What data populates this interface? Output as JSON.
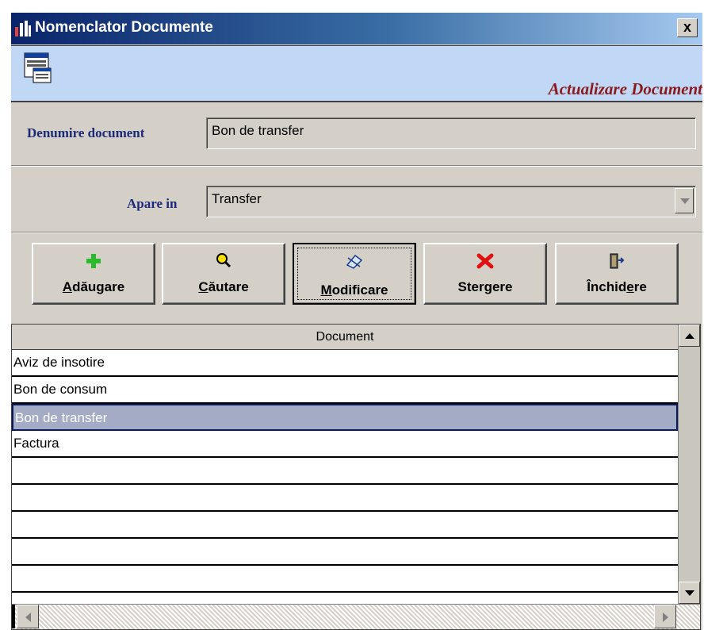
{
  "window": {
    "title": "Nomenclator Documente",
    "close_label": "x"
  },
  "banner": {
    "title": "Actualizare Document"
  },
  "form": {
    "name_label": "Denumire document",
    "name_value": "Bon de transfer",
    "appears_label": "Apare in",
    "appears_value": "Transfer"
  },
  "toolbar": {
    "buttons": [
      {
        "pre": "",
        "u": "A",
        "post": "dăugare",
        "icon": "plus-icon"
      },
      {
        "pre": "",
        "u": "C",
        "post": "ăutare",
        "icon": "magnifier-icon"
      },
      {
        "pre": "",
        "u": "M",
        "post": "odificare",
        "icon": "edit-icon"
      },
      {
        "pre": "Ster",
        "u": "g",
        "post": "ere",
        "icon": "delete-x-icon"
      },
      {
        "pre": "Închid",
        "u": "e",
        "post": "re",
        "icon": "exit-door-icon"
      }
    ],
    "active_index": 2
  },
  "grid": {
    "column_header": "Document",
    "rows": [
      "Aviz de insotire",
      "Bon de consum",
      "Bon de transfer",
      "Factura",
      "",
      "",
      "",
      "",
      ""
    ],
    "selected_index": 2
  },
  "colors": {
    "title_bar": "#0a246a",
    "banner_bg": "#c0d7f5",
    "banner_text": "#8b1a1a",
    "label_text": "#1b2a7a",
    "selected_row": "#a3acc4"
  }
}
